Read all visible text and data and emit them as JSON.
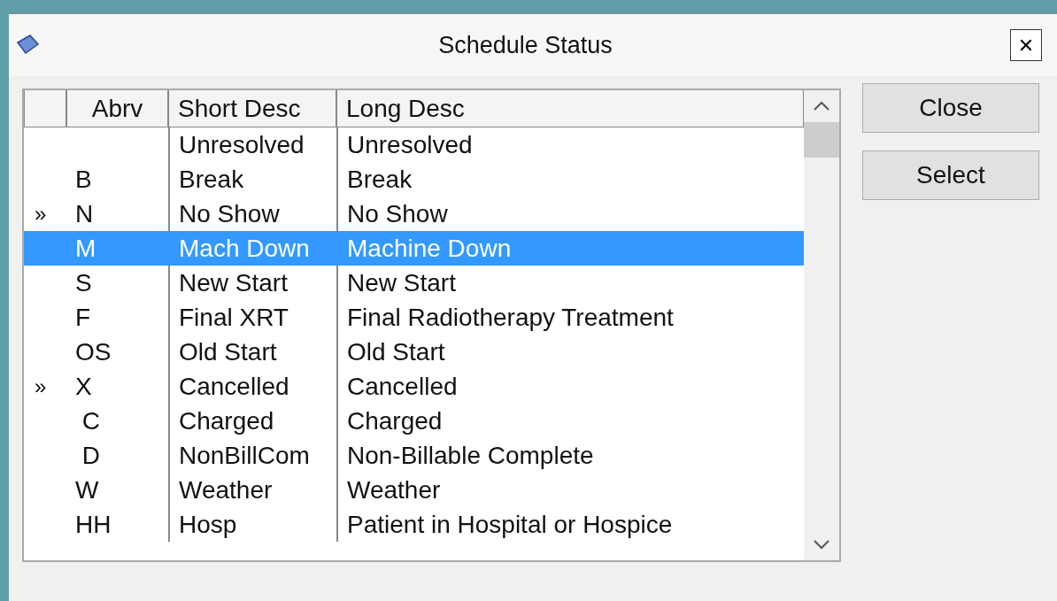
{
  "window": {
    "title": "Schedule Status",
    "close": "✕"
  },
  "table": {
    "columns": [
      "Abrv",
      "Short Desc",
      "Long Desc"
    ],
    "rows": [
      {
        "marker": "",
        "abrv": "",
        "short": "Unresolved",
        "long": "Unresolved",
        "selected": false
      },
      {
        "marker": "",
        "abrv": "B",
        "short": "Break",
        "long": "Break",
        "selected": false
      },
      {
        "marker": "»",
        "abrv": "N",
        "short": "No Show",
        "long": "No Show",
        "selected": false
      },
      {
        "marker": "",
        "abrv": "M",
        "short": "Mach Down",
        "long": "Machine Down",
        "selected": true
      },
      {
        "marker": "",
        "abrv": "S",
        "short": "New Start",
        "long": "New Start",
        "selected": false
      },
      {
        "marker": "",
        "abrv": "F",
        "short": "Final XRT",
        "long": "Final Radiotherapy Treatment",
        "selected": false
      },
      {
        "marker": "",
        "abrv": "OS",
        "short": "Old Start",
        "long": "Old Start",
        "selected": false
      },
      {
        "marker": "»",
        "abrv": "X",
        "short": "Cancelled",
        "long": "Cancelled",
        "selected": false
      },
      {
        "marker": "",
        "abrv": " C",
        "short": "Charged",
        "long": "Charged",
        "selected": false
      },
      {
        "marker": "",
        "abrv": " D",
        "short": "NonBillCom",
        "long": "Non-Billable Complete",
        "selected": false
      },
      {
        "marker": "",
        "abrv": "W",
        "short": "Weather",
        "long": "Weather",
        "selected": false
      },
      {
        "marker": "",
        "abrv": "HH",
        "short": "Hosp",
        "long": "Patient in Hospital or Hospice",
        "selected": false
      }
    ]
  },
  "buttons": [
    "Close",
    "Select"
  ]
}
